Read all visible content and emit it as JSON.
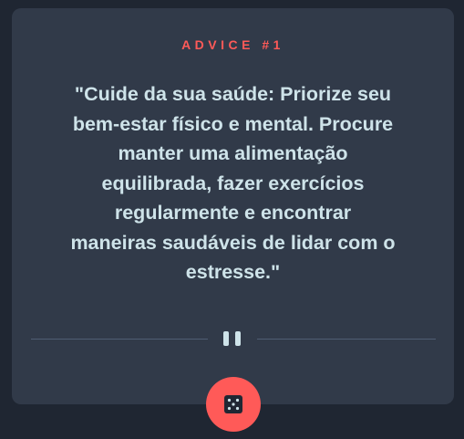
{
  "card": {
    "title": "ADVICE #1",
    "quote": "\"Cuide da sua saúde: Priorize seu bem-estar físico e mental. Procure manter uma alimentação equilibrada, fazer exercícios regularmente e encontrar maneiras saudáveis de lidar com o estresse.\""
  },
  "divider": {
    "icon": "pause-icon"
  },
  "button": {
    "icon": "dice-icon"
  },
  "colors": {
    "background": "#1f2632",
    "card": "#313a49",
    "accent": "#ff5a58",
    "text": "#cee3e9",
    "divider": "#4f5d73"
  }
}
